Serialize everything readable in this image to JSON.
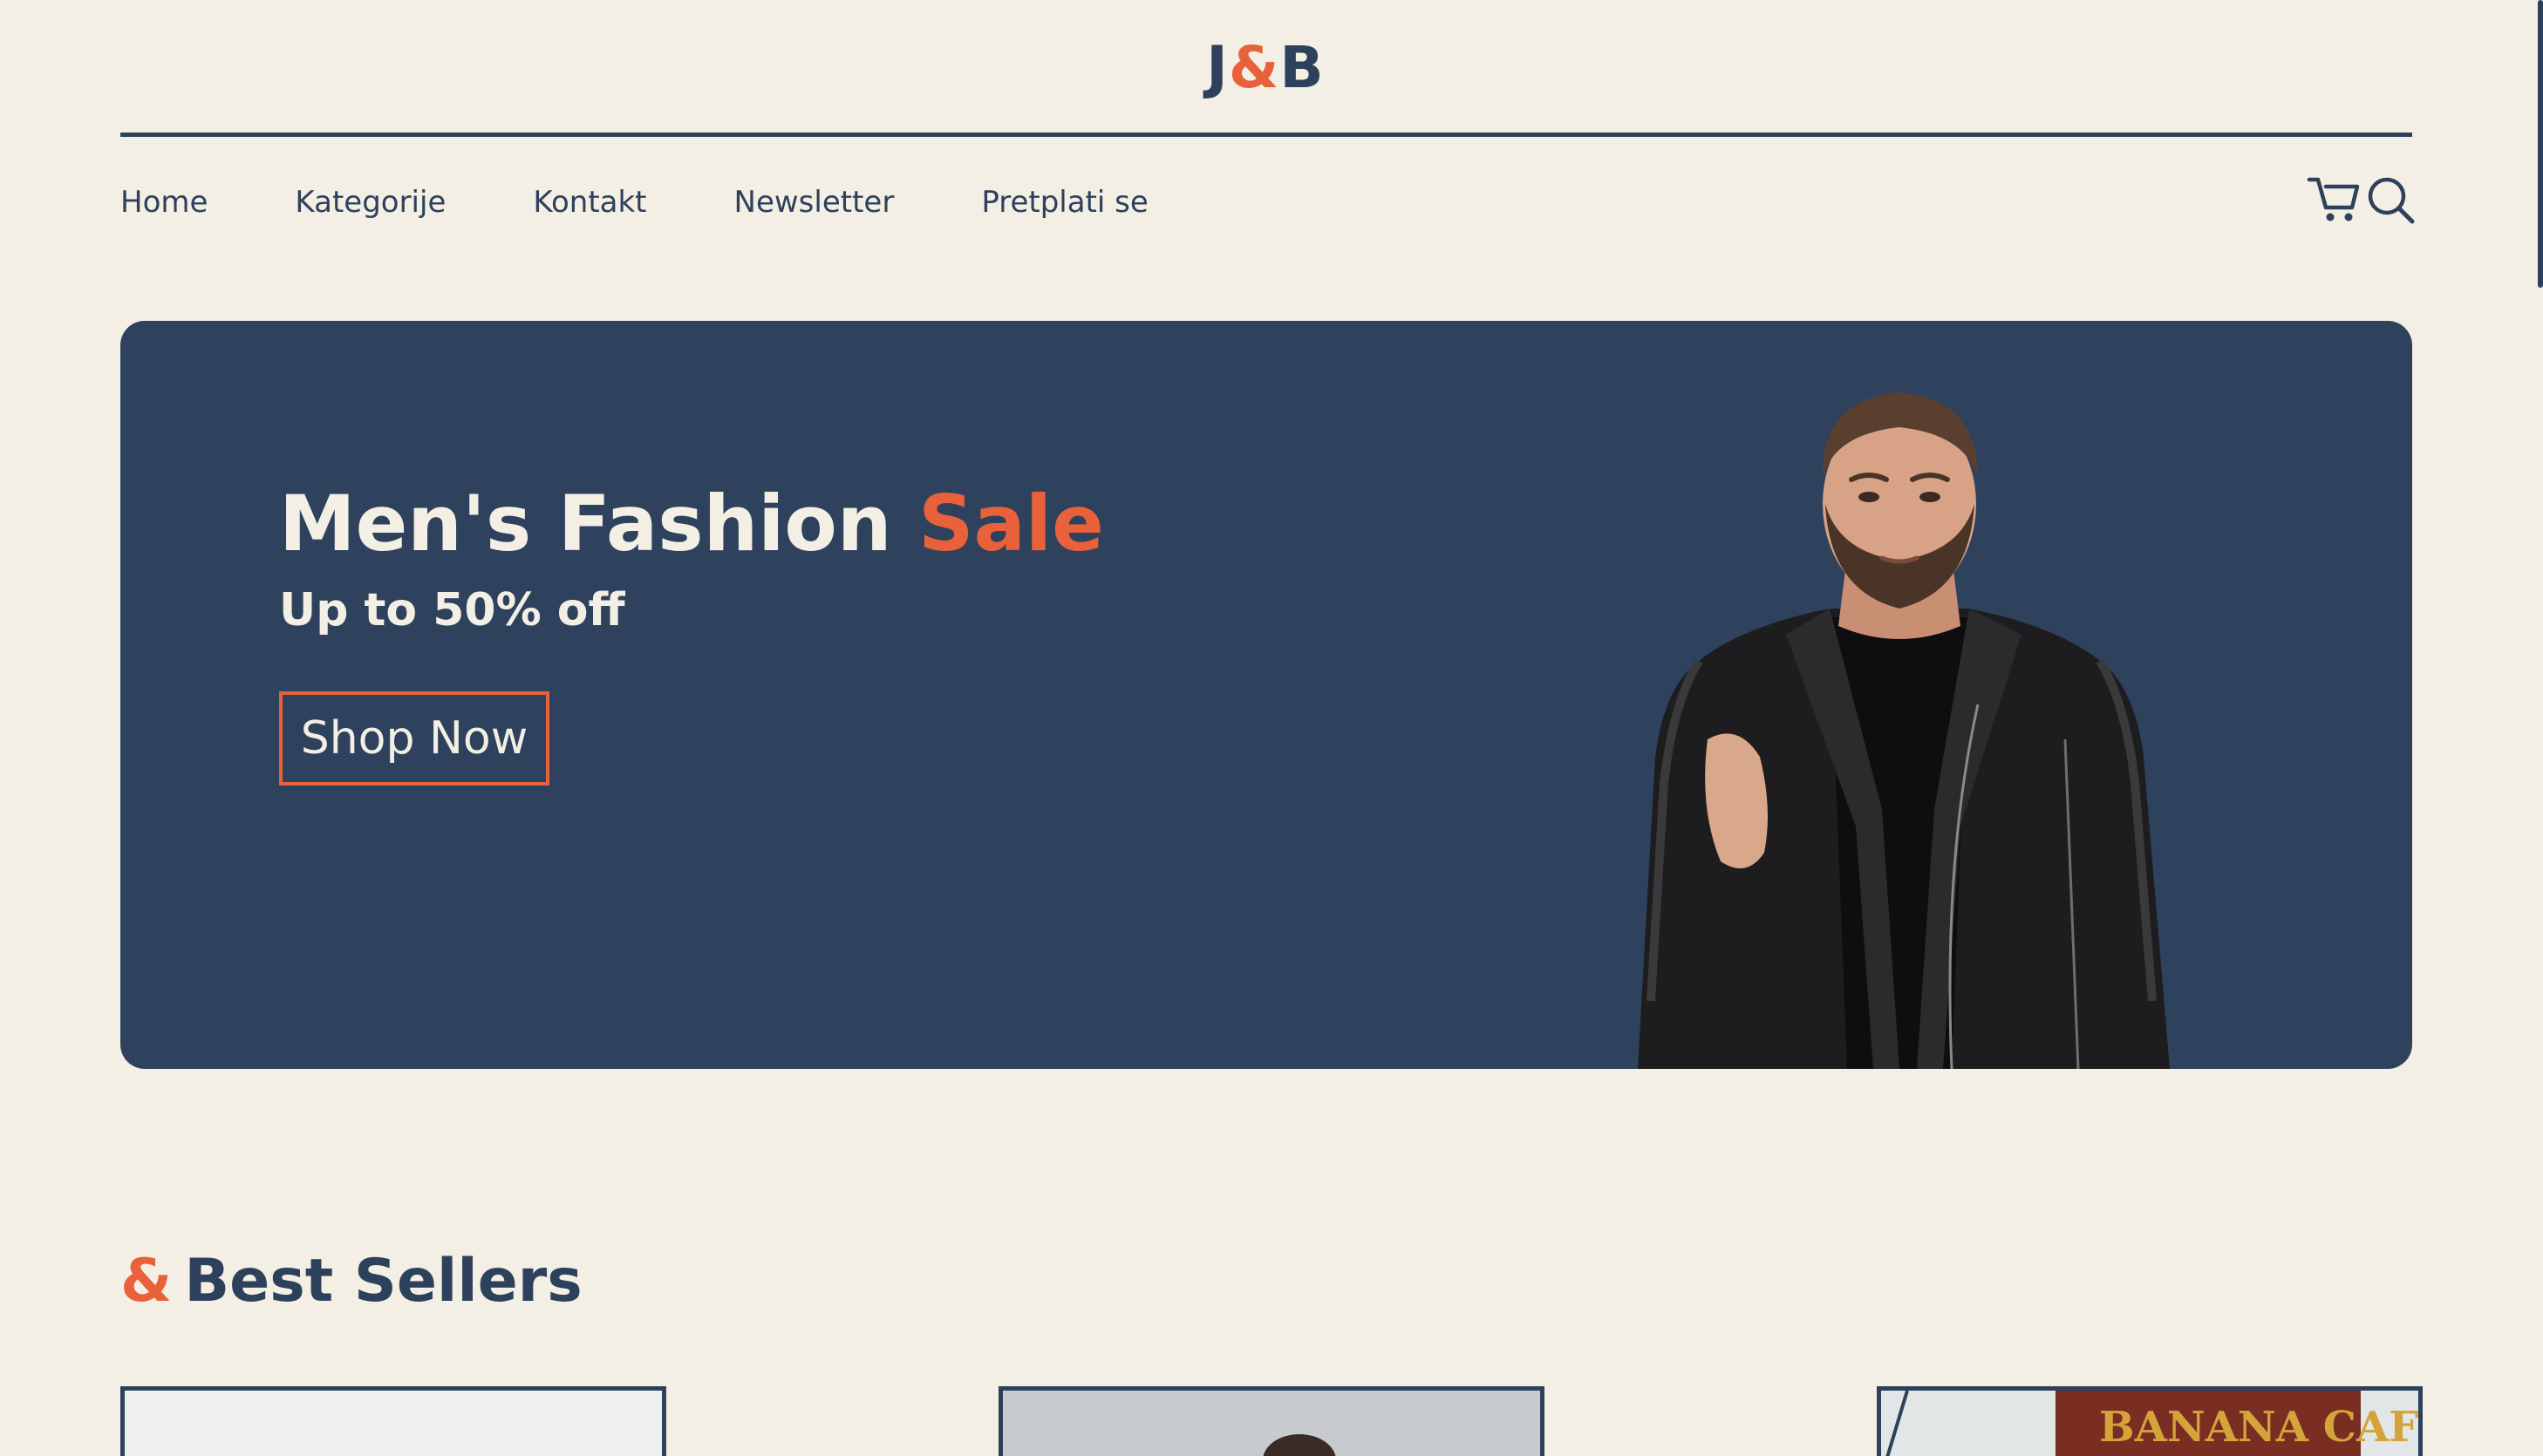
{
  "brand": {
    "logo_left": "J",
    "logo_amp": "&",
    "logo_right": "B"
  },
  "nav": {
    "items": [
      {
        "label": "Home"
      },
      {
        "label": "Kategorije"
      },
      {
        "label": "Kontakt"
      },
      {
        "label": "Newsletter"
      },
      {
        "label": "Pretplati se"
      }
    ],
    "icons": [
      "cart-icon",
      "search-icon"
    ]
  },
  "hero": {
    "title_main": "Men's Fashion ",
    "title_accent": "Sale",
    "subtitle": "Up to 50% off",
    "cta_label": "Shop Now",
    "image": "man-in-leather-jacket"
  },
  "best_sellers": {
    "title_amp": "&",
    "title": "Best Sellers",
    "card_images": [
      "product-photo-1",
      "product-photo-2",
      "product-photo-3-banana-cafe"
    ],
    "card3_sign_text": "BANANA CAFE"
  },
  "colors": {
    "background": "#f4efe4",
    "navy": "#2e415c",
    "accent": "#e8613a"
  }
}
